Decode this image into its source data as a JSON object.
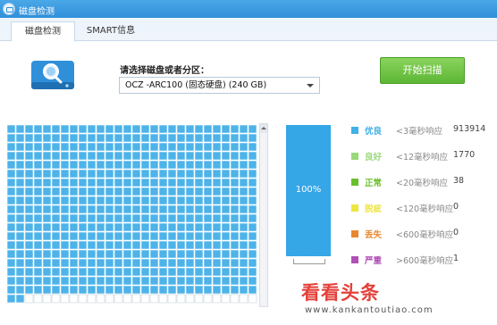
{
  "window": {
    "title": "磁盘检测"
  },
  "tabs": [
    {
      "label": "磁盘检测",
      "active": true
    },
    {
      "label": "SMART信息",
      "active": false
    }
  ],
  "disk_picker": {
    "label": "请选择磁盘或者分区：",
    "selected": "OCZ -ARC100 (固态硬盘)  (240 GB)"
  },
  "start_button": {
    "label": "开始扫描"
  },
  "scan_grid": {
    "columns": 28,
    "rows": 20,
    "filled_cells": 534,
    "fill_color": "#4db3e8",
    "empty_color": "#ffffff"
  },
  "progress": {
    "percent": 100,
    "label": "100%",
    "color": "#35a6e6"
  },
  "legend": [
    {
      "name": "优良",
      "desc": "<3毫秒响应",
      "count": "913914",
      "color": "#42b0e6"
    },
    {
      "name": "良好",
      "desc": "<12毫秒响应",
      "count": "1770",
      "color": "#9ad87b"
    },
    {
      "name": "正常",
      "desc": "<20毫秒响应",
      "count": "38",
      "color": "#6cbf2c"
    },
    {
      "name": "脱疵",
      "desc": "<120毫秒响应",
      "count": "0",
      "color": "#f0e640"
    },
    {
      "name": "丢失",
      "desc": "<600毫秒响应",
      "count": "0",
      "color": "#e8872f"
    },
    {
      "name": "严重",
      "desc": ">600毫秒响应",
      "count": "1",
      "color": "#b04fb8"
    }
  ],
  "watermark": {
    "big": "看看头条",
    "small": "www.kankantoutiao.com"
  },
  "icons": [
    "app-icon",
    "disk-search-icon",
    "dropdown-arrow-icon",
    "scroll-up-icon"
  ]
}
